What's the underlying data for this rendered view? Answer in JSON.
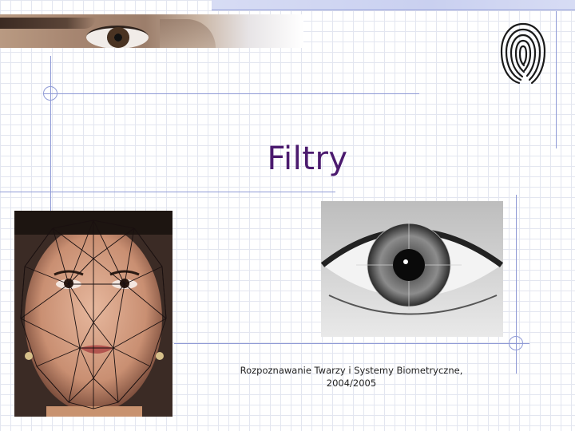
{
  "slide": {
    "title": "Filtry",
    "footer": {
      "line1": "Rozpoznawanie Twarzy i Systemy Biometryczne,",
      "line2": "2004/2005"
    }
  },
  "images": {
    "eye_banner": "eye-close-up-strip",
    "fingerprint": "fingerprint-icon",
    "face_mesh": "face-with-triangle-mesh-photo",
    "iris": "iris-close-up-photo"
  },
  "colors": {
    "background": "#ffffff",
    "grid": "#e3e6f0",
    "guide_lines": "#8f9ad6",
    "title": "#4b1a6e",
    "footer_text": "#222222"
  }
}
